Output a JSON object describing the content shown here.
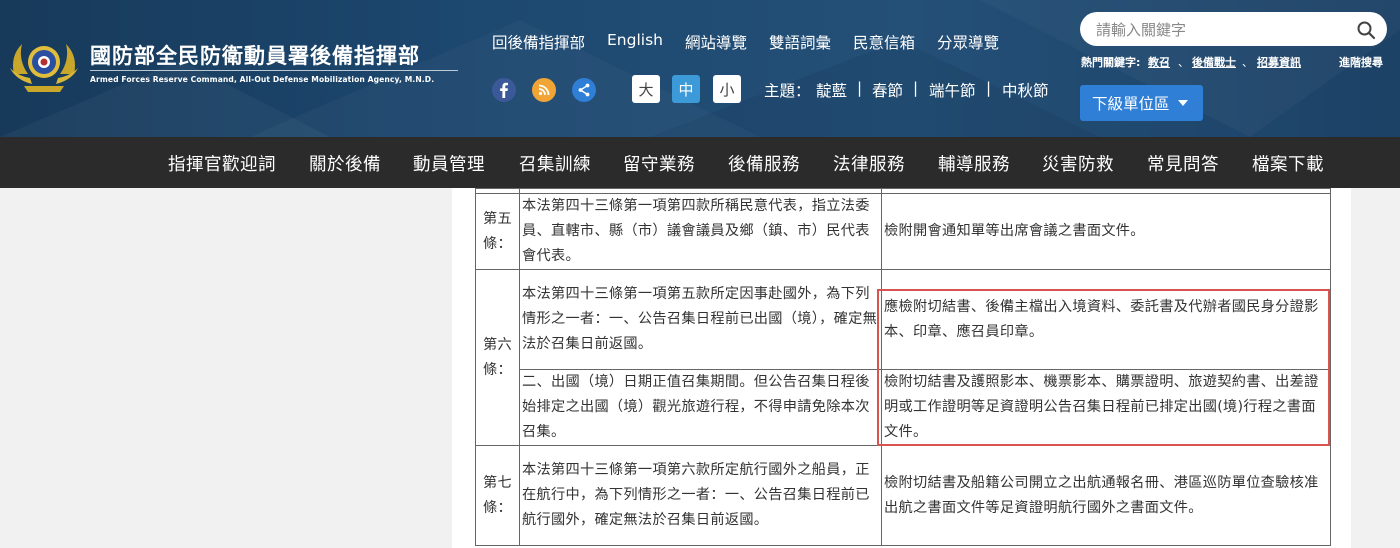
{
  "header": {
    "title": "國防部全民防衛動員署後備指揮部",
    "subtitle": "Armed Forces Reserve Command, All-Out Defense Mobilization Agency, M.N.D.",
    "top_links": [
      "回後備指揮部",
      "English",
      "網站導覽",
      "雙語詞彙",
      "民意信箱",
      "分眾導覽"
    ],
    "font_sizes": [
      "大",
      "中",
      "小"
    ],
    "active_font_size": "中",
    "theme_label": "主題：",
    "themes": [
      "靛藍",
      "春節",
      "端午節",
      "中秋節"
    ],
    "search": {
      "placeholder": "請輸入關鍵字"
    },
    "hot_keywords_label": "熱門關鍵字:",
    "hot_keywords": [
      "教召",
      "後備戰士",
      "招募資訊"
    ],
    "advanced_search": "進階搜尋",
    "dropdown_label": "下級單位區",
    "social_icons": [
      "facebook-icon",
      "rss-icon",
      "share-icon"
    ],
    "colors": {
      "header_bg": "#1d4870",
      "nav_bg": "#2b2b2b",
      "accent_blue": "#2f7fd6",
      "highlight": "#d9534f"
    }
  },
  "nav": {
    "items": [
      "指揮官歡迎詞",
      "關於後備",
      "動員管理",
      "召集訓練",
      "留守業務",
      "後備服務",
      "法律服務",
      "輔導服務",
      "災害防救",
      "常見問答",
      "檔案下載"
    ]
  },
  "table": {
    "art5": {
      "label": "第五條：",
      "cond": "本法第四十三條第一項第四款所稱民意代表，指立法委員、直轄市、縣（市）議會議員及鄉（鎮、市）民代表會代表。",
      "doc": "檢附開會通知單等出席會議之書面文件。"
    },
    "art6": {
      "label": "第六條：",
      "cond1": "本法第四十三條第一項第五款所定因事赴國外，為下列情形之一者：一、公告召集日程前已出國（境），確定無法於召集日前返國。",
      "doc1": "應檢附切結書、後備主檔出入境資料、委託書及代辦者國民身分證影本、印章、應召員印章。",
      "cond2": "二、出國（境）日期正值召集期間。但公告召集日程後始排定之出國（境）觀光旅遊行程，不得申請免除本次召集。",
      "doc2": "檢附切結書及護照影本、機票影本、購票證明、旅遊契約書、出差證明或工作證明等足資證明公告召集日程前已排定出國(境)行程之書面文件。"
    },
    "art7": {
      "label": "第七條：",
      "cond": "本法第四十三條第一項第六款所定航行國外之船員，正在航行中，為下列情形之一者：一、公告召集日程前已航行國外，確定無法於召集日前返國。",
      "doc": "檢附切結書及船籍公司開立之出航通報名冊、港區巡防單位查驗核准出航之書面文件等足資證明航行國外之書面文件。"
    }
  }
}
